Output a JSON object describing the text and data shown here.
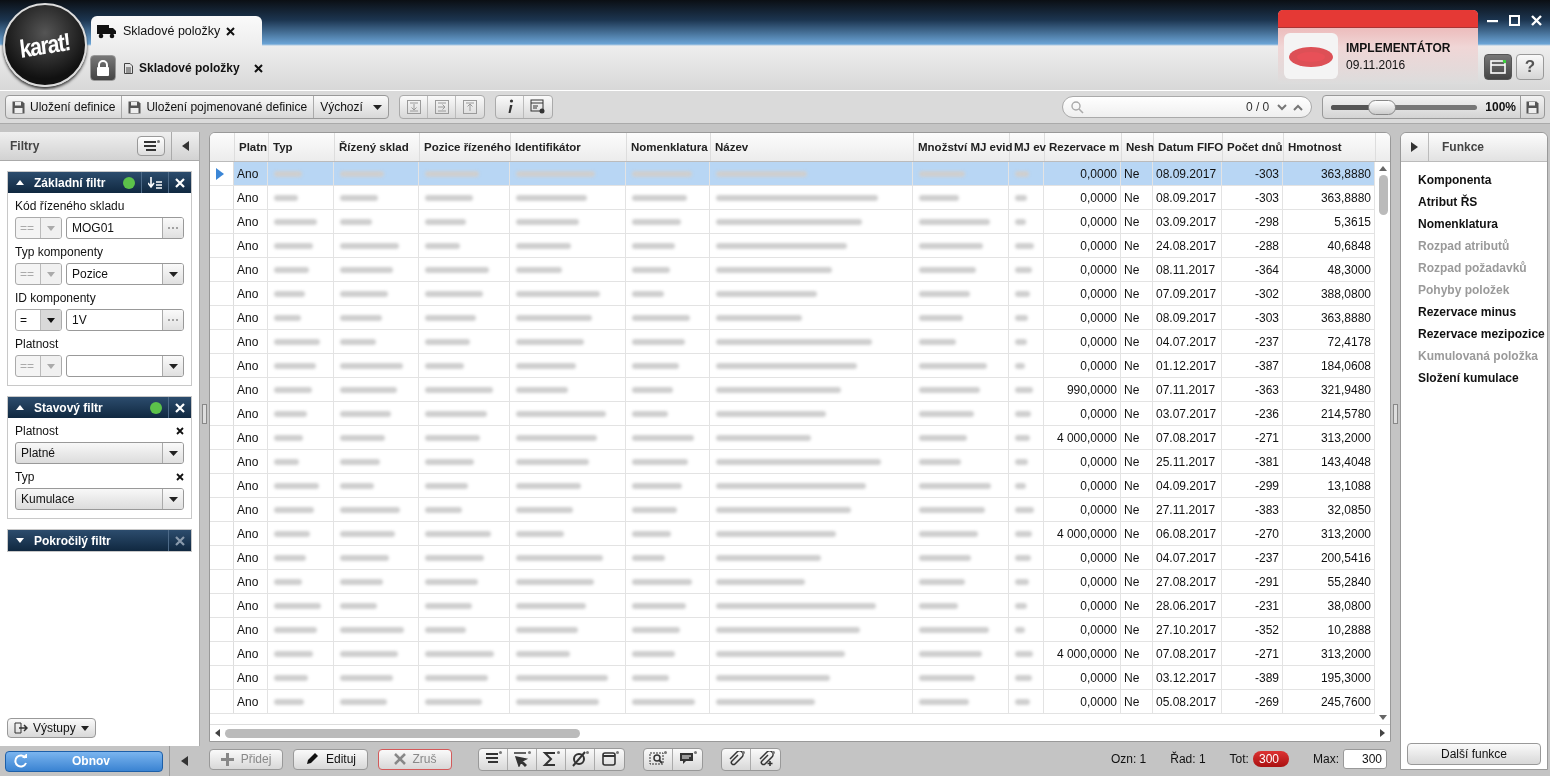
{
  "logo": "karat!",
  "tabs": [
    {
      "label": "Skladové položky",
      "selected": true
    }
  ],
  "document_tab": {
    "label": "Skladové položky",
    "locked": true
  },
  "user": {
    "role": "IMPLEMENTÁTOR",
    "date": "09.11.2016"
  },
  "help_button": "?",
  "toolbar": {
    "buttons": [
      {
        "label": "Uložení definice"
      },
      {
        "label": "Uložení pojmenované definice"
      }
    ],
    "view_select": "Výchozí",
    "tool_icons": [
      {
        "kind": "collapse",
        "disabled": true
      },
      {
        "kind": "expand",
        "disabled": true
      },
      {
        "kind": "upload",
        "disabled": true
      },
      {
        "kind": "info",
        "disabled": false
      },
      {
        "kind": "settings",
        "disabled": false
      }
    ],
    "search": {
      "counter": "0 / 0"
    },
    "zoom": {
      "level": 0.35,
      "reading": "100%"
    }
  },
  "filters": {
    "title": "Filtry",
    "sections": [
      {
        "title": "Základní filtr",
        "expanded": true,
        "active": true,
        "sortable": true,
        "fields": [
          {
            "kind": "operator",
            "label": "Kód řízeného skladu",
            "operator": "==",
            "operator_disabled": true,
            "value": "MOG01",
            "dropdown": false
          },
          {
            "kind": "operator",
            "label": "Typ komponenty",
            "operator": "==",
            "operator_disabled": true,
            "value": "Pozice",
            "dropdown": true
          },
          {
            "kind": "operator",
            "label": "ID komponenty",
            "operator": "=",
            "operator_disabled": false,
            "value": "1V",
            "dropdown": false
          },
          {
            "kind": "operator",
            "label": "Platnost",
            "operator": "==",
            "operator_disabled": true,
            "dropdown": true
          }
        ]
      },
      {
        "title": "Stavový filtr",
        "expanded": true,
        "active": true,
        "fields": [
          {
            "kind": "select",
            "label": "Platnost",
            "value": "Platné"
          },
          {
            "kind": "select",
            "label": "Typ",
            "value": "Kumulace"
          }
        ]
      },
      {
        "title": "Pokročilý filtr",
        "expanded": false,
        "active": false
      }
    ],
    "outputs_button": "Výstupy",
    "refresh_button": "Obnov"
  },
  "grid": {
    "columns": [
      {
        "label": "Platn",
        "kind": "text"
      },
      {
        "label": "Typ",
        "kind": "blurred"
      },
      {
        "label": "Řízený sklad",
        "kind": "blurred"
      },
      {
        "label": "Pozice řízeného",
        "kind": "blurred"
      },
      {
        "label": "Identifikátor",
        "kind": "blurred"
      },
      {
        "label": "Nomenklatura",
        "kind": "blurred"
      },
      {
        "label": "Název",
        "kind": "blurred"
      },
      {
        "label": "Množství MJ evid",
        "kind": "blurred"
      },
      {
        "label": "MJ ev",
        "kind": "blurred"
      },
      {
        "label": "Rezervace m",
        "kind": "number"
      },
      {
        "label": "Nesh",
        "kind": "text"
      },
      {
        "label": "Datum FIFO",
        "kind": "text"
      },
      {
        "label": "Počet dnů",
        "kind": "number"
      },
      {
        "label": "Hmotnost",
        "kind": "number"
      }
    ],
    "rows": [
      {
        "selected": true,
        "cells": [
          "Ano",
          "0,0000",
          "Ne",
          "08.09.2017",
          "-303",
          "363,8880"
        ]
      },
      {
        "selected": false,
        "cells": [
          "Ano",
          "0,0000",
          "Ne",
          "08.09.2017",
          "-303",
          "363,8880"
        ]
      },
      {
        "selected": false,
        "cells": [
          "Ano",
          "0,0000",
          "Ne",
          "03.09.2017",
          "-298",
          "5,3615"
        ]
      },
      {
        "selected": false,
        "cells": [
          "Ano",
          "0,0000",
          "Ne",
          "24.08.2017",
          "-288",
          "40,6848"
        ]
      },
      {
        "selected": false,
        "cells": [
          "Ano",
          "0,0000",
          "Ne",
          "08.11.2017",
          "-364",
          "48,3000"
        ]
      },
      {
        "selected": false,
        "cells": [
          "Ano",
          "0,0000",
          "Ne",
          "07.09.2017",
          "-302",
          "388,0800"
        ]
      },
      {
        "selected": false,
        "cells": [
          "Ano",
          "0,0000",
          "Ne",
          "08.09.2017",
          "-303",
          "363,8880"
        ]
      },
      {
        "selected": false,
        "cells": [
          "Ano",
          "0,0000",
          "Ne",
          "04.07.2017",
          "-237",
          "72,4178"
        ]
      },
      {
        "selected": false,
        "cells": [
          "Ano",
          "0,0000",
          "Ne",
          "01.12.2017",
          "-387",
          "184,0608"
        ]
      },
      {
        "selected": false,
        "cells": [
          "Ano",
          "990,0000",
          "Ne",
          "07.11.2017",
          "-363",
          "321,9480"
        ]
      },
      {
        "selected": false,
        "cells": [
          "Ano",
          "0,0000",
          "Ne",
          "03.07.2017",
          "-236",
          "214,5780"
        ]
      },
      {
        "selected": false,
        "cells": [
          "Ano",
          "4 000,0000",
          "Ne",
          "07.08.2017",
          "-271",
          "313,2000"
        ]
      },
      {
        "selected": false,
        "cells": [
          "Ano",
          "0,0000",
          "Ne",
          "25.11.2017",
          "-381",
          "143,4048"
        ]
      },
      {
        "selected": false,
        "cells": [
          "Ano",
          "0,0000",
          "Ne",
          "04.09.2017",
          "-299",
          "13,1088"
        ]
      },
      {
        "selected": false,
        "cells": [
          "Ano",
          "0,0000",
          "Ne",
          "27.11.2017",
          "-383",
          "32,0850"
        ]
      },
      {
        "selected": false,
        "cells": [
          "Ano",
          "4 000,0000",
          "Ne",
          "06.08.2017",
          "-270",
          "313,2000"
        ]
      },
      {
        "selected": false,
        "cells": [
          "Ano",
          "0,0000",
          "Ne",
          "04.07.2017",
          "-237",
          "200,5416"
        ]
      },
      {
        "selected": false,
        "cells": [
          "Ano",
          "0,0000",
          "Ne",
          "27.08.2017",
          "-291",
          "55,2840"
        ]
      },
      {
        "selected": false,
        "cells": [
          "Ano",
          "0,0000",
          "Ne",
          "28.06.2017",
          "-231",
          "38,0800"
        ]
      },
      {
        "selected": false,
        "cells": [
          "Ano",
          "0,0000",
          "Ne",
          "27.10.2017",
          "-352",
          "10,2888"
        ]
      },
      {
        "selected": false,
        "cells": [
          "Ano",
          "4 000,0000",
          "Ne",
          "07.08.2017",
          "-271",
          "313,2000"
        ]
      },
      {
        "selected": false,
        "cells": [
          "Ano",
          "0,0000",
          "Ne",
          "03.12.2017",
          "-389",
          "195,3000"
        ]
      },
      {
        "selected": false,
        "cells": [
          "Ano",
          "0,0000",
          "Ne",
          "05.08.2017",
          "-269",
          "245,7600"
        ]
      }
    ]
  },
  "actions": [
    {
      "label": "Přidej",
      "kind": "add",
      "disabled": true
    },
    {
      "label": "Edituj",
      "kind": "edit",
      "disabled": false
    },
    {
      "label": "Zruš",
      "kind": "cancel",
      "disabled": true
    }
  ],
  "action_icons": [
    {
      "kind": "rows"
    },
    {
      "kind": "pointer"
    },
    {
      "kind": "sum"
    },
    {
      "kind": "empty"
    },
    {
      "kind": "window"
    },
    {
      "kind": "find"
    },
    {
      "kind": "comment"
    },
    {
      "kind": "clip"
    },
    {
      "kind": "clip-add"
    }
  ],
  "status": [
    {
      "label": "Ozn:",
      "value": "1",
      "kind": "plain"
    },
    {
      "label": "Řad:",
      "value": "1",
      "kind": "plain"
    },
    {
      "label": "Tot:",
      "value": "300",
      "kind": "pill"
    },
    {
      "label": "Max:",
      "value": "300",
      "kind": "field"
    }
  ],
  "functions": {
    "title": "Funkce",
    "items": [
      {
        "label": "Komponenta",
        "disabled": false
      },
      {
        "label": "Atribut ŘS",
        "disabled": false
      },
      {
        "label": "Nomenklatura",
        "disabled": false
      },
      {
        "label": "Rozpad atributů",
        "disabled": true
      },
      {
        "label": "Rozpad požadavků",
        "disabled": true
      },
      {
        "label": "Pohyby položek",
        "disabled": true
      },
      {
        "label": "Rezervace minus",
        "disabled": false
      },
      {
        "label": "Rezervace mezipozice",
        "disabled": false
      },
      {
        "label": "Kumulovaná položka",
        "disabled": true
      },
      {
        "label": "Složení kumulace",
        "disabled": false
      }
    ],
    "more_button": "Další funkce"
  }
}
